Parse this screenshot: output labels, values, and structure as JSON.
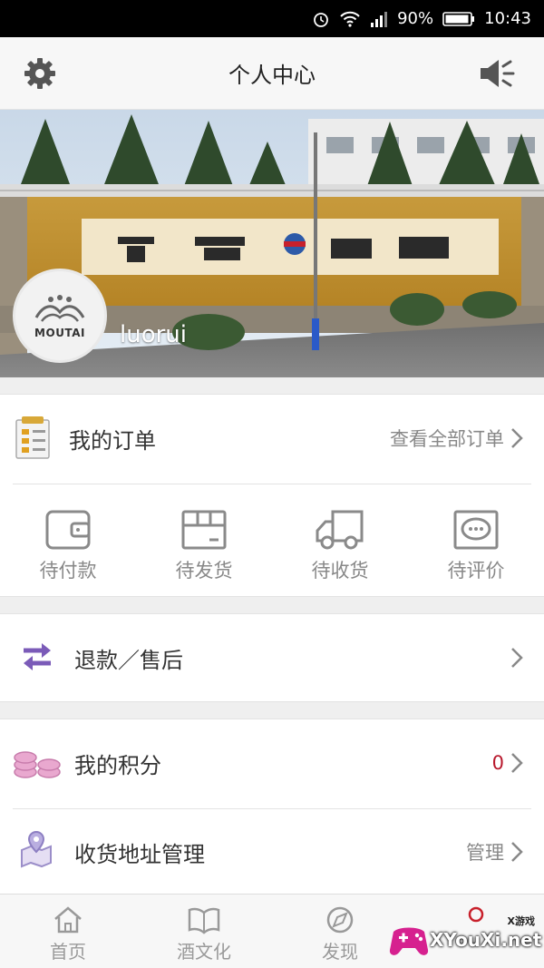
{
  "status_bar": {
    "battery": "90%",
    "time": "10:43"
  },
  "header": {
    "title": "个人中心"
  },
  "profile": {
    "avatar_brand": "MOUTAI",
    "username": "luorui"
  },
  "orders": {
    "title": "我的订单",
    "view_all": "查看全部订单",
    "statuses": [
      {
        "label": "待付款",
        "icon": "wallet-icon"
      },
      {
        "label": "待发货",
        "icon": "package-icon"
      },
      {
        "label": "待收货",
        "icon": "truck-icon"
      },
      {
        "label": "待评价",
        "icon": "comment-icon"
      }
    ]
  },
  "refund": {
    "label": "退款／售后"
  },
  "points": {
    "label": "我的积分",
    "value": "0",
    "value_color": "#b8182c"
  },
  "address": {
    "label": "收货地址管理",
    "action": "管理"
  },
  "tabbar": {
    "tabs": [
      {
        "label": "首页",
        "icon": "home-icon"
      },
      {
        "label": "酒文化",
        "icon": "book-icon"
      },
      {
        "label": "发现",
        "icon": "compass-icon"
      }
    ]
  },
  "watermark": {
    "text": "XYouXi.net",
    "small": "X游戏"
  }
}
